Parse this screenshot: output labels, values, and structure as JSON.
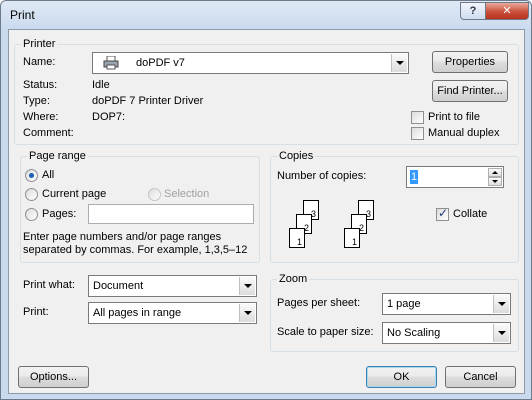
{
  "window": {
    "title": "Print",
    "help": "?",
    "close": "✕"
  },
  "printer": {
    "group_label": "Printer",
    "name_label": "Name:",
    "name_value": "doPDF v7",
    "status_label": "Status:",
    "status_value": "Idle",
    "type_label": "Type:",
    "type_value": "doPDF 7 Printer Driver",
    "where_label": "Where:",
    "where_value": "DOP7:",
    "comment_label": "Comment:",
    "properties_button": "Properties",
    "find_printer_button": "Find Printer...",
    "print_to_file": "Print to file",
    "manual_duplex": "Manual duplex"
  },
  "page_range": {
    "group_label": "Page range",
    "all": "All",
    "current_page": "Current page",
    "selection": "Selection",
    "pages": "Pages:",
    "hint_line1": "Enter page numbers and/or page ranges",
    "hint_line2": "separated by commas.  For example, 1,3,5–12"
  },
  "copies": {
    "group_label": "Copies",
    "number_label": "Number of copies:",
    "number_value": "1",
    "collate": "Collate",
    "stack1": [
      "3",
      "2",
      "1"
    ],
    "stack2": [
      "3",
      "2",
      "1"
    ]
  },
  "print_what": {
    "label": "Print what:",
    "value": "Document"
  },
  "print": {
    "label": "Print:",
    "value": "All pages in range"
  },
  "zoom": {
    "group_label": "Zoom",
    "pages_per_sheet_label": "Pages per sheet:",
    "pages_per_sheet_value": "1 page",
    "scale_label": "Scale to paper size:",
    "scale_value": "No Scaling"
  },
  "footer": {
    "options": "Options...",
    "ok": "OK",
    "cancel": "Cancel"
  },
  "colors": {
    "accent": "#3399ff",
    "checkmark": "#1c3b78",
    "close": "#c9503a"
  }
}
